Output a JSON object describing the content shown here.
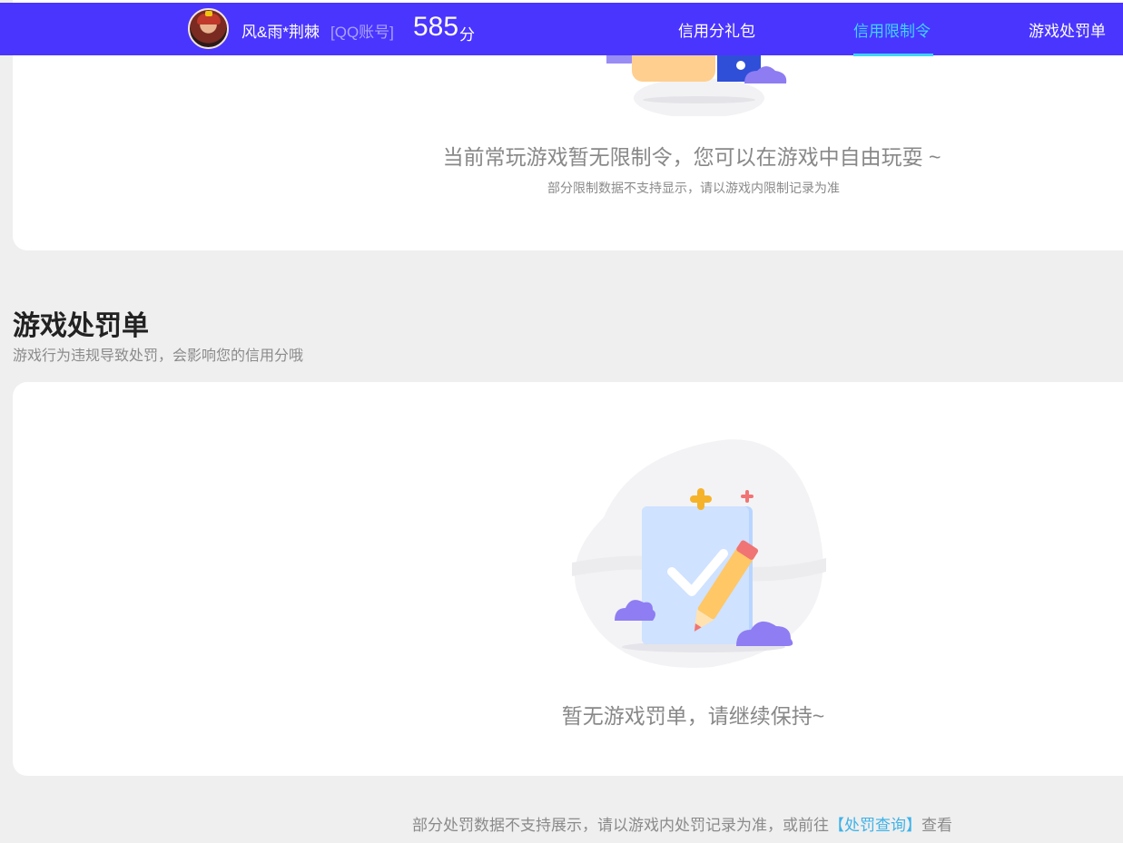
{
  "header": {
    "user_name": "风&雨*荆棘",
    "account_type": "[QQ账号]",
    "score": "585",
    "score_unit": "分",
    "nav_tabs": [
      {
        "label": "信用分礼包",
        "active": false
      },
      {
        "label": "信用限制令",
        "active": true
      },
      {
        "label": "游戏处罚单",
        "active": false
      }
    ]
  },
  "restriction": {
    "empty_title": "当前常玩游戏暂无限制令，您可以在游戏中自由玩耍 ~",
    "empty_subtitle": "部分限制数据不支持显示，请以游戏内限制记录为准"
  },
  "penalty": {
    "title": "游戏处罚单",
    "subtitle": "游戏行为违规导致处罚，会影响您的信用分哦",
    "empty_title": "暂无游戏罚单，请继续保持~"
  },
  "footer": {
    "note_prefix": "部分处罚数据不支持展示，请以游戏内处罚记录为准，或前往",
    "link_label": "【处罚查询】",
    "note_suffix": "查看"
  },
  "colors": {
    "brand": "#4a35ff",
    "active_tab": "#3fd4ff",
    "link": "#3eb2e8",
    "background": "#efefef"
  },
  "icons": [
    "avatar",
    "empty-restriction-illustration",
    "empty-penalty-illustration"
  ]
}
